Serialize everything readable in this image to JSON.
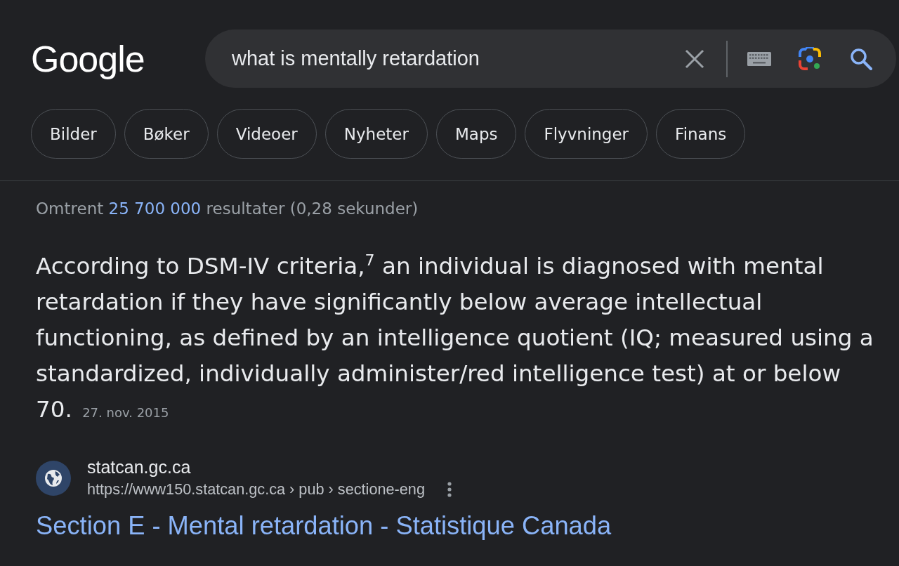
{
  "header": {
    "logo": "Google",
    "search": {
      "value": "what is mentally retardation"
    }
  },
  "filter_chips": [
    {
      "label": "Bilder"
    },
    {
      "label": "Bøker"
    },
    {
      "label": "Videoer"
    },
    {
      "label": "Nyheter"
    },
    {
      "label": "Maps"
    },
    {
      "label": "Flyvninger"
    },
    {
      "label": "Finans"
    }
  ],
  "result_stats": {
    "prefix": "Omtrent",
    "count": "25 700 000",
    "suffix": "resultater (0,28 sekunder)"
  },
  "featured_snippet": {
    "text": "According to DSM-IV criteria,$^{7}$ an individual is diagnosed with mental retardation if they have significantly below average intellectual functioning, as defined by an intelligence quotient (IQ; measured using a standardized, individually administer/red intelligence test) at or below 70.",
    "date": "27. nov. 2015"
  },
  "result": {
    "site_name": "statcan.gc.ca",
    "url": "https://www150.statcan.gc.ca › pub › sectione-eng",
    "title": "Section E - Mental retardation - Statistique Canada"
  }
}
